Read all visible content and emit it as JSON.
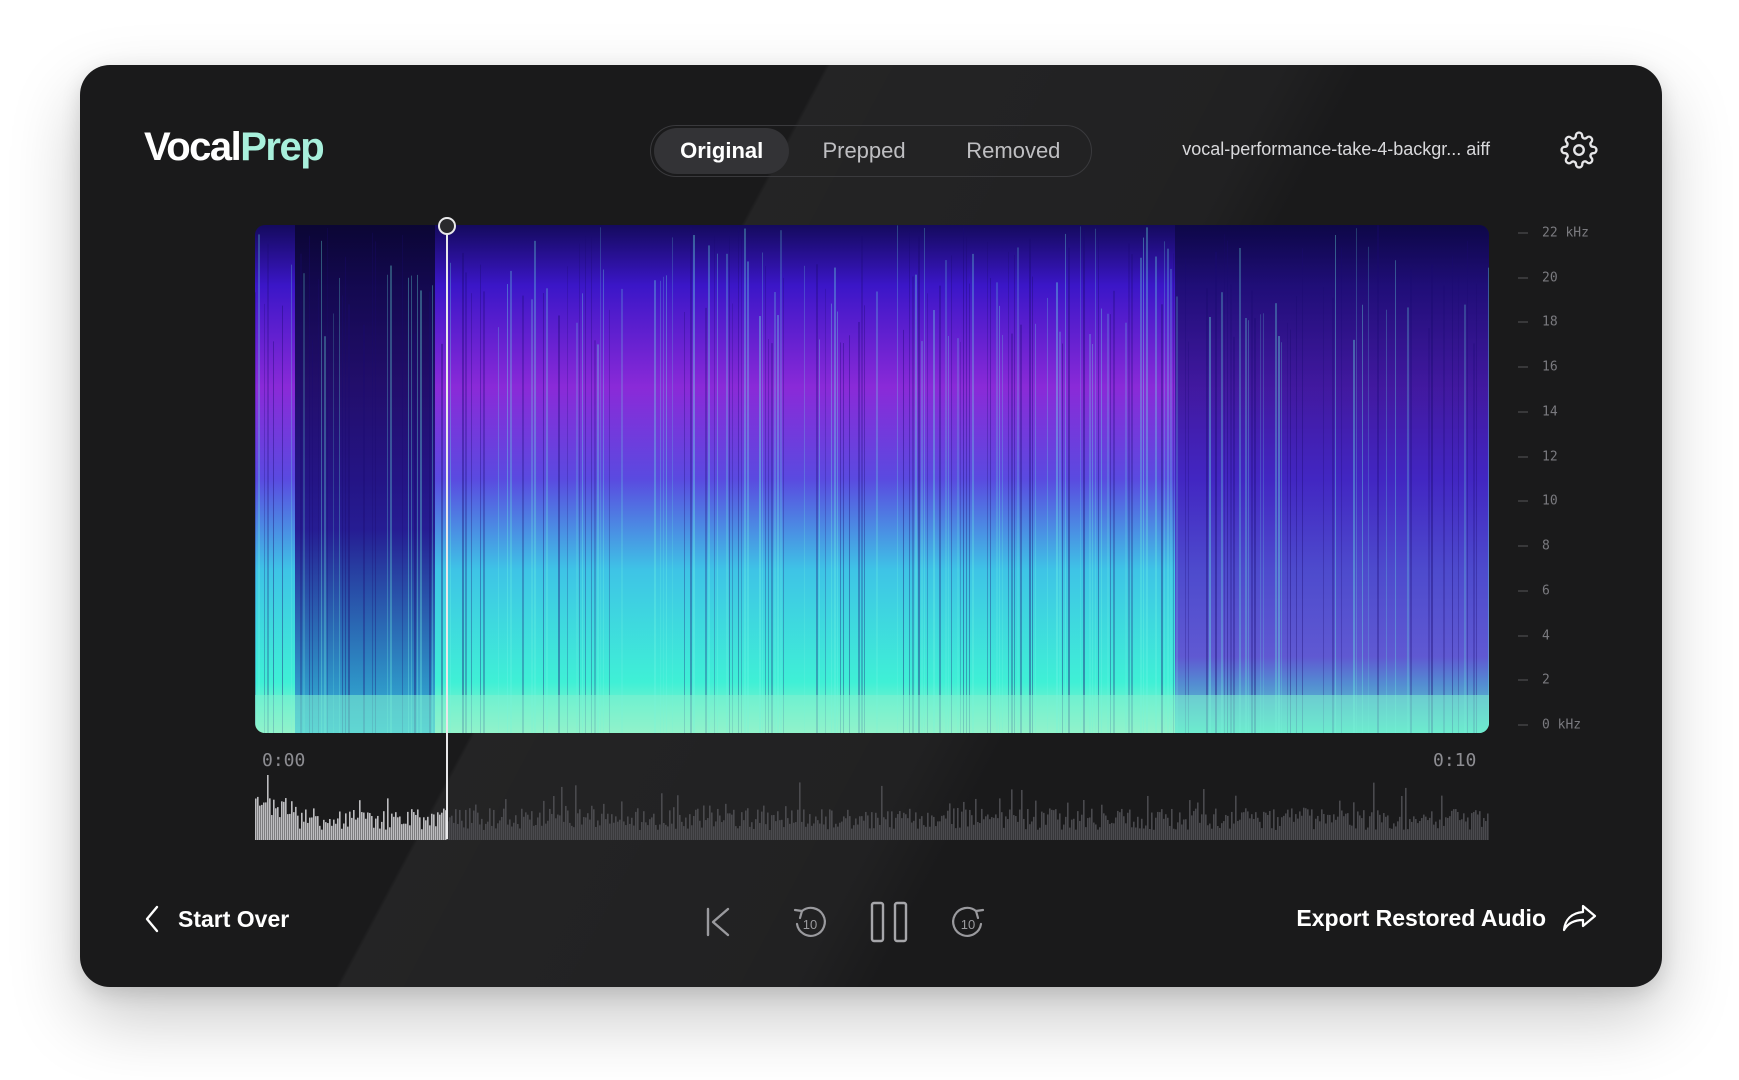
{
  "app": {
    "logo_main": "Vocal",
    "logo_accent": "Prep"
  },
  "tabs": [
    {
      "label": "Original",
      "active": true
    },
    {
      "label": "Prepped",
      "active": false
    },
    {
      "label": "Removed",
      "active": false
    }
  ],
  "file": {
    "name": "vocal-performance-take-4-backgr... aiff"
  },
  "spectrogram": {
    "freq_axis": [
      "22 kHz",
      "20",
      "18",
      "16",
      "14",
      "12",
      "10",
      "8",
      "6",
      "4",
      "2",
      "0 kHz"
    ],
    "start_time": "0:00",
    "end_time": "0:10",
    "playhead_fraction": 0.154
  },
  "footer": {
    "start_over_label": "Start Over",
    "export_label": "Export Restored Audio"
  },
  "transport": {
    "skip_back_seconds": "10",
    "skip_forward_seconds": "10"
  },
  "colors": {
    "accent": "#a8f0dc",
    "background": "#1a1a1b",
    "spectro_low": "#1f0a8a",
    "spectro_mid": "#9a2ad6",
    "spectro_high": "#3ff0d6"
  }
}
